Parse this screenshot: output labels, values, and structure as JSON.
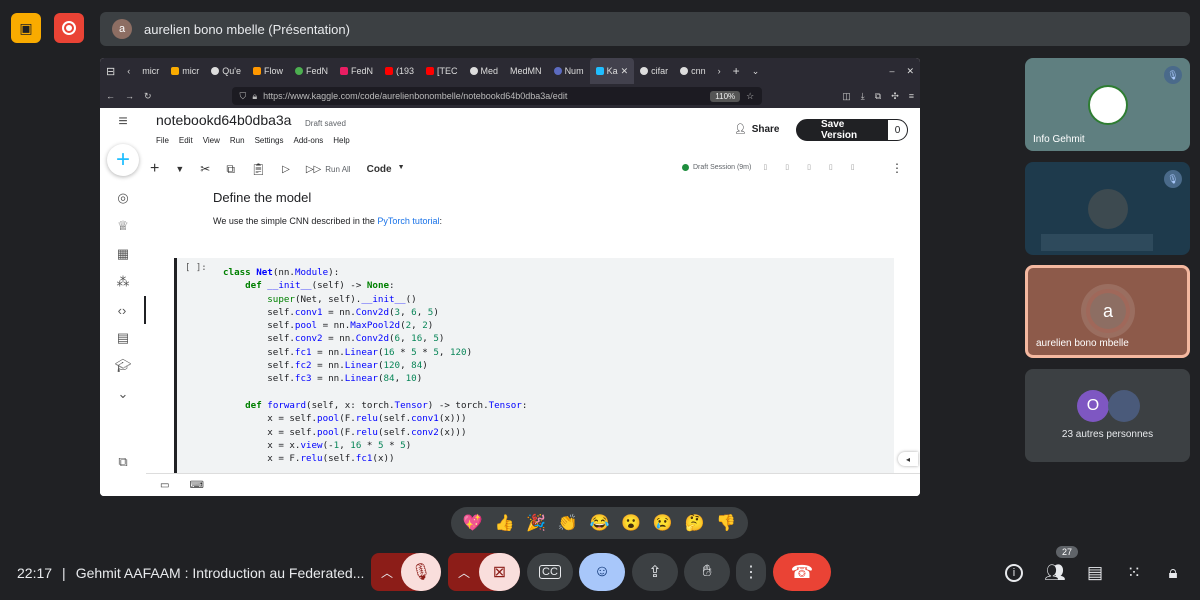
{
  "meeting": {
    "presenter_label": "aurelien bono mbelle (Présentation)",
    "presenter_avatar_letter": "a",
    "time": "22:17",
    "separator": "|",
    "meeting_title": "Gehmit AAFAAM : Introduction au Federated...",
    "participants_count": "27"
  },
  "browser": {
    "tabs": [
      "micr",
      "micr",
      "Qu'e",
      "Flow",
      "FedN",
      "FedN",
      "(193",
      "[TEC",
      "Med",
      "MedMN",
      "Num",
      "Ka",
      "cifar",
      "cnn"
    ],
    "url": "https://www.kaggle.com/code/aurelienbonombelle/notebookd64b0dba3a/edit",
    "zoom": "110%"
  },
  "kaggle": {
    "notebook_title": "notebookd64b0dba3a",
    "save_status": "Draft saved",
    "menu": [
      "File",
      "Edit",
      "View",
      "Run",
      "Settings",
      "Add-ons",
      "Help"
    ],
    "share_label": "Share",
    "save_version_label": "Save Version",
    "save_version_count": "0",
    "run_all_label": "Run All",
    "cell_type": "Code",
    "session_label": "Draft Session (9m)",
    "markdown_heading": "Define the model",
    "markdown_text_pre": "We use the simple CNN described in the ",
    "markdown_link": "PyTorch tutorial",
    "markdown_text_post": ":",
    "cell_prompt": "[ ]:"
  },
  "participants": [
    {
      "name": "Info Gehmit",
      "muted": true
    },
    {
      "name": "",
      "muted": true
    },
    {
      "name": "aurelien bono mbelle",
      "avatar_letter": "a",
      "active": true
    },
    {
      "name": "23 autres personnes",
      "avatar_letter": "O"
    }
  ],
  "reactions": [
    "💖",
    "👍",
    "🎉",
    "👏",
    "😂",
    "😮",
    "😢",
    "🤔",
    "👎"
  ],
  "colors": {
    "accent_yellow": "#f9ab00",
    "record_red": "#ea4335",
    "end_call_red": "#ea4335",
    "mic_off_bg": "#f9dedc",
    "active_tile_border": "#f4b8a0"
  }
}
